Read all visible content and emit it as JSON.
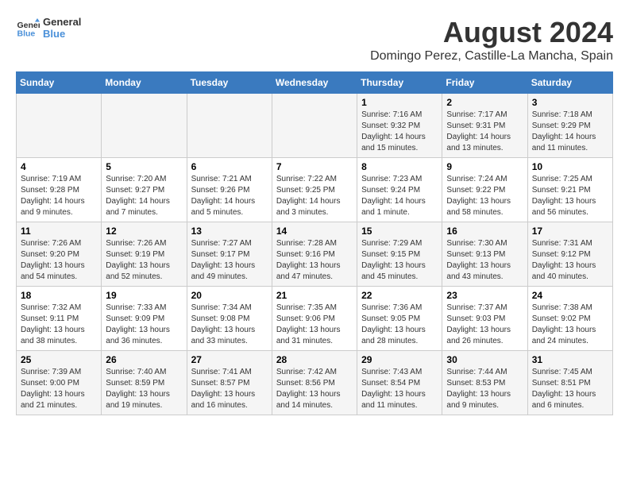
{
  "header": {
    "logo_line1": "General",
    "logo_line2": "Blue",
    "main_title": "August 2024",
    "subtitle": "Domingo Perez, Castille-La Mancha, Spain"
  },
  "days_of_week": [
    "Sunday",
    "Monday",
    "Tuesday",
    "Wednesday",
    "Thursday",
    "Friday",
    "Saturday"
  ],
  "weeks": [
    [
      {
        "day": "",
        "info": ""
      },
      {
        "day": "",
        "info": ""
      },
      {
        "day": "",
        "info": ""
      },
      {
        "day": "",
        "info": ""
      },
      {
        "day": "1",
        "info": "Sunrise: 7:16 AM\nSunset: 9:32 PM\nDaylight: 14 hours and 15 minutes."
      },
      {
        "day": "2",
        "info": "Sunrise: 7:17 AM\nSunset: 9:31 PM\nDaylight: 14 hours and 13 minutes."
      },
      {
        "day": "3",
        "info": "Sunrise: 7:18 AM\nSunset: 9:29 PM\nDaylight: 14 hours and 11 minutes."
      }
    ],
    [
      {
        "day": "4",
        "info": "Sunrise: 7:19 AM\nSunset: 9:28 PM\nDaylight: 14 hours and 9 minutes."
      },
      {
        "day": "5",
        "info": "Sunrise: 7:20 AM\nSunset: 9:27 PM\nDaylight: 14 hours and 7 minutes."
      },
      {
        "day": "6",
        "info": "Sunrise: 7:21 AM\nSunset: 9:26 PM\nDaylight: 14 hours and 5 minutes."
      },
      {
        "day": "7",
        "info": "Sunrise: 7:22 AM\nSunset: 9:25 PM\nDaylight: 14 hours and 3 minutes."
      },
      {
        "day": "8",
        "info": "Sunrise: 7:23 AM\nSunset: 9:24 PM\nDaylight: 14 hours and 1 minute."
      },
      {
        "day": "9",
        "info": "Sunrise: 7:24 AM\nSunset: 9:22 PM\nDaylight: 13 hours and 58 minutes."
      },
      {
        "day": "10",
        "info": "Sunrise: 7:25 AM\nSunset: 9:21 PM\nDaylight: 13 hours and 56 minutes."
      }
    ],
    [
      {
        "day": "11",
        "info": "Sunrise: 7:26 AM\nSunset: 9:20 PM\nDaylight: 13 hours and 54 minutes."
      },
      {
        "day": "12",
        "info": "Sunrise: 7:26 AM\nSunset: 9:19 PM\nDaylight: 13 hours and 52 minutes."
      },
      {
        "day": "13",
        "info": "Sunrise: 7:27 AM\nSunset: 9:17 PM\nDaylight: 13 hours and 49 minutes."
      },
      {
        "day": "14",
        "info": "Sunrise: 7:28 AM\nSunset: 9:16 PM\nDaylight: 13 hours and 47 minutes."
      },
      {
        "day": "15",
        "info": "Sunrise: 7:29 AM\nSunset: 9:15 PM\nDaylight: 13 hours and 45 minutes."
      },
      {
        "day": "16",
        "info": "Sunrise: 7:30 AM\nSunset: 9:13 PM\nDaylight: 13 hours and 43 minutes."
      },
      {
        "day": "17",
        "info": "Sunrise: 7:31 AM\nSunset: 9:12 PM\nDaylight: 13 hours and 40 minutes."
      }
    ],
    [
      {
        "day": "18",
        "info": "Sunrise: 7:32 AM\nSunset: 9:11 PM\nDaylight: 13 hours and 38 minutes."
      },
      {
        "day": "19",
        "info": "Sunrise: 7:33 AM\nSunset: 9:09 PM\nDaylight: 13 hours and 36 minutes."
      },
      {
        "day": "20",
        "info": "Sunrise: 7:34 AM\nSunset: 9:08 PM\nDaylight: 13 hours and 33 minutes."
      },
      {
        "day": "21",
        "info": "Sunrise: 7:35 AM\nSunset: 9:06 PM\nDaylight: 13 hours and 31 minutes."
      },
      {
        "day": "22",
        "info": "Sunrise: 7:36 AM\nSunset: 9:05 PM\nDaylight: 13 hours and 28 minutes."
      },
      {
        "day": "23",
        "info": "Sunrise: 7:37 AM\nSunset: 9:03 PM\nDaylight: 13 hours and 26 minutes."
      },
      {
        "day": "24",
        "info": "Sunrise: 7:38 AM\nSunset: 9:02 PM\nDaylight: 13 hours and 24 minutes."
      }
    ],
    [
      {
        "day": "25",
        "info": "Sunrise: 7:39 AM\nSunset: 9:00 PM\nDaylight: 13 hours and 21 minutes."
      },
      {
        "day": "26",
        "info": "Sunrise: 7:40 AM\nSunset: 8:59 PM\nDaylight: 13 hours and 19 minutes."
      },
      {
        "day": "27",
        "info": "Sunrise: 7:41 AM\nSunset: 8:57 PM\nDaylight: 13 hours and 16 minutes."
      },
      {
        "day": "28",
        "info": "Sunrise: 7:42 AM\nSunset: 8:56 PM\nDaylight: 13 hours and 14 minutes."
      },
      {
        "day": "29",
        "info": "Sunrise: 7:43 AM\nSunset: 8:54 PM\nDaylight: 13 hours and 11 minutes."
      },
      {
        "day": "30",
        "info": "Sunrise: 7:44 AM\nSunset: 8:53 PM\nDaylight: 13 hours and 9 minutes."
      },
      {
        "day": "31",
        "info": "Sunrise: 7:45 AM\nSunset: 8:51 PM\nDaylight: 13 hours and 6 minutes."
      }
    ]
  ]
}
